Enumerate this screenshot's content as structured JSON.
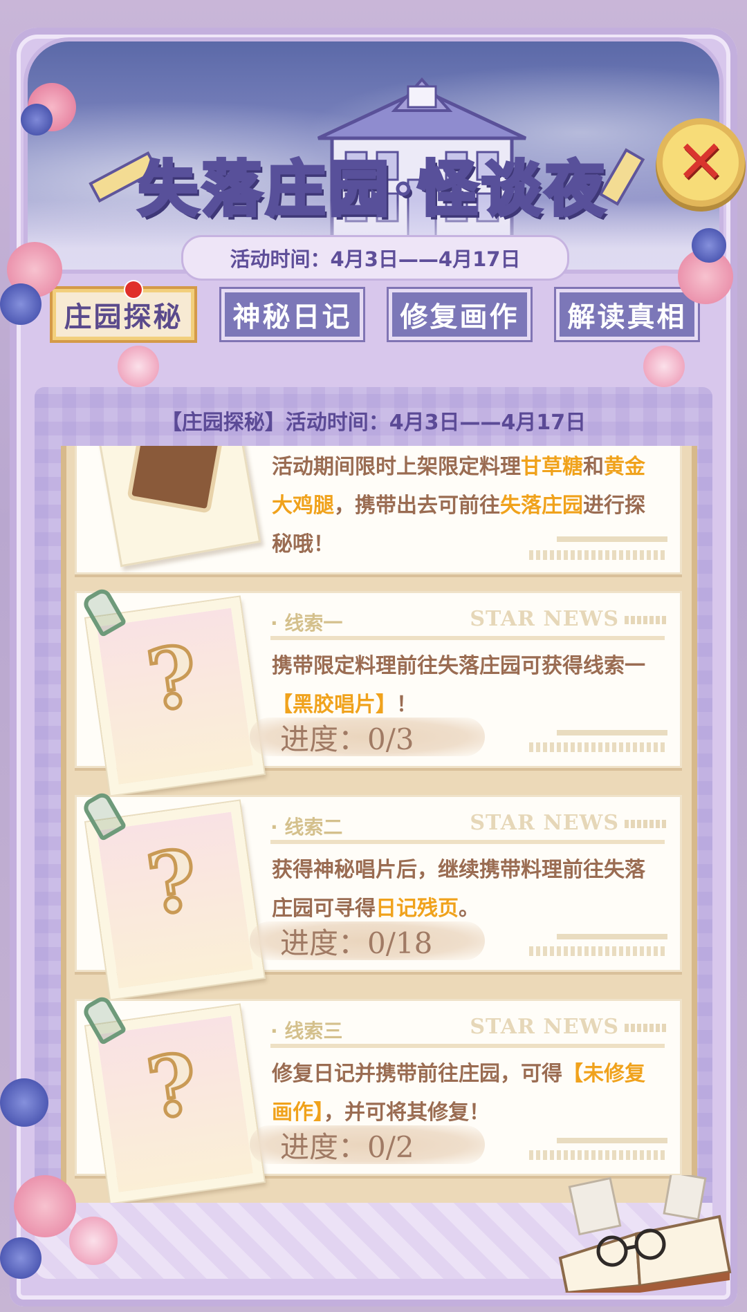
{
  "header": {
    "title": "失落庄园·怪谈夜",
    "date": "活动时间：4月3日——4月17日"
  },
  "close_label": "✕",
  "tabs": [
    {
      "label": "庄园探秘",
      "active": true,
      "has_dot": true
    },
    {
      "label": "神秘日记",
      "active": false
    },
    {
      "label": "修复画作",
      "active": false
    },
    {
      "label": "解读真相",
      "active": false
    }
  ],
  "panel": {
    "title": "【庄园探秘】活动时间：4月3日——4月17日"
  },
  "intro": {
    "seg1": "活动期间限时上架限定料理",
    "seg2": "甘草糖",
    "seg3": "和",
    "seg4": "黄金大鸡腿",
    "seg5": "，携带出去可前往",
    "seg6": "失落庄园",
    "seg7": "进行探秘哦！"
  },
  "clues": [
    {
      "title": "· 线索一",
      "badge": "STAR NEWS",
      "desc_a": "携带限定料理前往失落庄园可获得线索一",
      "desc_hl": "【黑胶唱片】",
      "desc_b": "！",
      "progress": "进度：0/3",
      "icon": "question-mark"
    },
    {
      "title": "· 线索二",
      "badge": "STAR NEWS",
      "desc_a": "获得神秘唱片后，继续携带料理前往失落庄园可寻得",
      "desc_hl": "日记残页",
      "desc_b": "。",
      "progress": "进度：0/18",
      "icon": "question-mark"
    },
    {
      "title": "· 线索三",
      "badge": "STAR NEWS",
      "desc_a": "修复日记并携带前往庄园，可得",
      "desc_hl": "【未修复画作】",
      "desc_b": "，并可将其修复！",
      "progress": "进度：0/2",
      "icon": "question-mark"
    }
  ],
  "colors": {
    "accent": "#f0a21c",
    "text_brown": "#9a6c52",
    "tab_bg": "#7c77b8",
    "tab_active_bg": "#f7ead3",
    "close_red": "#d9352e"
  }
}
